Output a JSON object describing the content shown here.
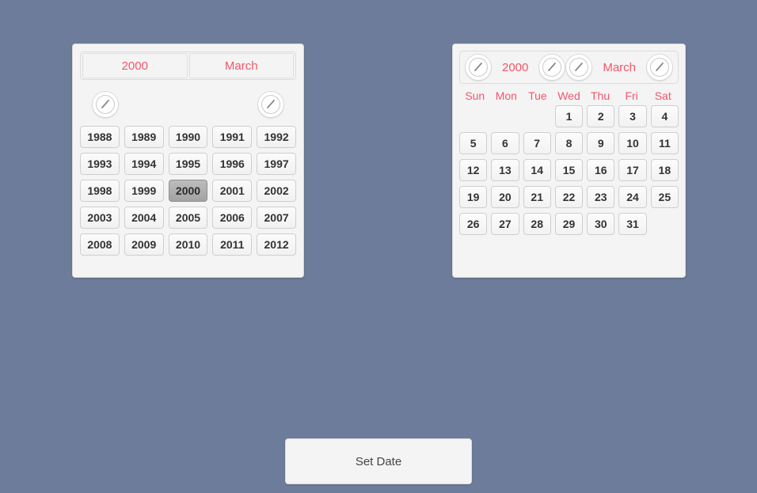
{
  "theme": {
    "background": "#6d7c9a",
    "panel_background": "#f4f4f4",
    "accent_red": "#f2566c",
    "cell_text": "#333333",
    "selected_cell": "#b0b0b0"
  },
  "year_panel": {
    "tabs": [
      {
        "label": "2000",
        "name": "tab-year"
      },
      {
        "label": "March",
        "name": "tab-month"
      }
    ],
    "nav": {
      "prev": {
        "icon": "circle-prev-arrow-icon",
        "label": ""
      },
      "next": {
        "icon": "circle-next-arrow-icon",
        "label": ""
      }
    },
    "selected_year": "2000",
    "years": [
      "1988",
      "1989",
      "1990",
      "1991",
      "1992",
      "1993",
      "1994",
      "1995",
      "1996",
      "1997",
      "1998",
      "1999",
      "2000",
      "2001",
      "2002",
      "2003",
      "2004",
      "2005",
      "2006",
      "2007",
      "2008",
      "2009",
      "2010",
      "2011",
      "2012"
    ]
  },
  "calendar_panel": {
    "header": {
      "prev_year_icon": "circle-prev-arrow-icon",
      "year_label": "2000",
      "next_year_icon": "circle-next-arrow-icon",
      "prev_month_icon": "circle-prev-arrow-icon",
      "month_label": "March",
      "next_month_icon": "circle-next-arrow-icon"
    },
    "weekdays": [
      "Sun",
      "Mon",
      "Tue",
      "Wed",
      "Thu",
      "Fri",
      "Sat"
    ],
    "leading_blanks": 3,
    "days": [
      "1",
      "2",
      "3",
      "4",
      "5",
      "6",
      "7",
      "8",
      "9",
      "10",
      "11",
      "12",
      "13",
      "14",
      "15",
      "16",
      "17",
      "18",
      "19",
      "20",
      "21",
      "22",
      "23",
      "24",
      "25",
      "26",
      "27",
      "28",
      "29",
      "30",
      "31"
    ],
    "trailing_blanks": 1
  },
  "footer": {
    "set_date_label": "Set Date"
  }
}
